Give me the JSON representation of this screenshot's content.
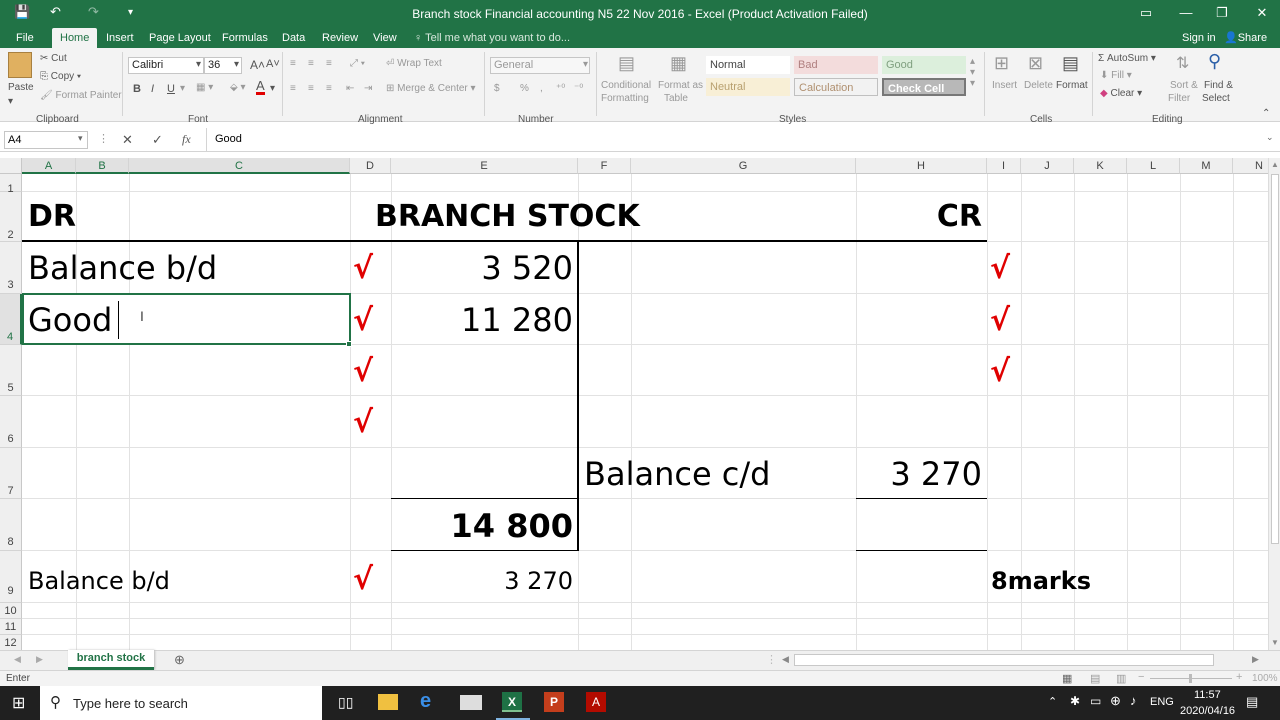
{
  "title": "Branch stock Financial accounting N5 22 Nov 2016 - Excel (Product Activation Failed)",
  "qat": {
    "save": "💾",
    "undo": "↶",
    "redo": "↷"
  },
  "account": {
    "signin": "Sign in",
    "share": "Share"
  },
  "tabs": [
    "File",
    "Home",
    "Insert",
    "Page Layout",
    "Formulas",
    "Data",
    "Review",
    "View"
  ],
  "tell_me": "Tell me what you want to do...",
  "ribbon": {
    "clipboard": {
      "paste": "Paste",
      "cut": "Cut",
      "copy": "Copy",
      "format_painter": "Format Painter",
      "group": "Clipboard"
    },
    "font": {
      "name": "Calibri",
      "size": "36",
      "group": "Font",
      "bold": "B",
      "italic": "I",
      "underline": "U"
    },
    "alignment": {
      "wrap": "Wrap Text",
      "merge": "Merge & Center",
      "group": "Alignment"
    },
    "number": {
      "format": "General",
      "group": "Number",
      "currency": "$",
      "percent": "%",
      "comma": ","
    },
    "styles": {
      "cond_1": "Conditional",
      "cond_2": "Formatting",
      "table_1": "Format as",
      "table_2": "Table",
      "normal": "Normal",
      "bad": "Bad",
      "good": "Good",
      "neutral": "Neutral",
      "calculation": "Calculation",
      "check_cell": "Check Cell",
      "group": "Styles"
    },
    "cells": {
      "insert": "Insert",
      "delete": "Delete",
      "format": "Format",
      "group": "Cells"
    },
    "editing": {
      "autosum": "AutoSum",
      "fill": "Fill",
      "clear": "Clear",
      "sort_1": "Sort &",
      "sort_2": "Filter",
      "find_1": "Find &",
      "find_2": "Select",
      "group": "Editing"
    }
  },
  "formula_bar": {
    "name_box": "A4",
    "cancel": "✕",
    "enter": "✓",
    "fx": "fx",
    "content": "Good"
  },
  "columns": [
    "A",
    "B",
    "C",
    "D",
    "E",
    "F",
    "G",
    "H",
    "I",
    "J",
    "K",
    "L",
    "M",
    "N"
  ],
  "rows": [
    "1",
    "2",
    "3",
    "4",
    "5",
    "6",
    "7",
    "8",
    "9",
    "10",
    "11",
    "12"
  ],
  "cells": {
    "dr": "DR",
    "branch_stock": "BRANCH STOCK",
    "cr": "CR",
    "bal_bd": "Balance b/d",
    "val_3520": "3 520",
    "good": "Good",
    "val_11280": "11 280",
    "bal_cd": "Balance c/d",
    "val_3270_cr": "3 270",
    "total": "14 800",
    "bal_bd_2": "Balance b/d",
    "val_3270": "3 270",
    "marks": "8marks"
  },
  "tick": "√",
  "sheet_tab": "branch stock",
  "status": "Enter",
  "zoom": "100%",
  "taskbar": {
    "search": "Type here to search",
    "lang": "ENG",
    "time": "11:57",
    "date": "2020/04/16"
  },
  "colors": {
    "excel_green": "#217346",
    "tick_red": "#e00000"
  }
}
